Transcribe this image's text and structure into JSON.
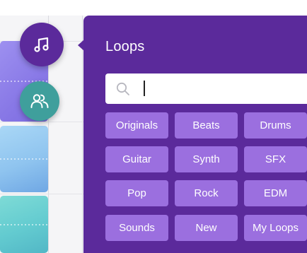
{
  "panel": {
    "title": "Loops",
    "search": {
      "value": "",
      "placeholder": ""
    },
    "chips": [
      [
        "Originals",
        "Beats",
        "Drums"
      ],
      [
        "Guitar",
        "Synth",
        "SFX"
      ],
      [
        "Pop",
        "Rock",
        "EDM"
      ],
      [
        "Sounds",
        "New",
        "My Loops"
      ]
    ]
  },
  "sidebar": {
    "buttons": [
      {
        "icon": "music-note-icon",
        "color": "#5b2a9b"
      },
      {
        "icon": "collaborators-icon",
        "color": "#3f9f9c"
      }
    ]
  },
  "colors": {
    "panel_bg": "#5b2a9b",
    "chip_bg": "#9b6fdf",
    "collab_button": "#3f9f9c"
  }
}
